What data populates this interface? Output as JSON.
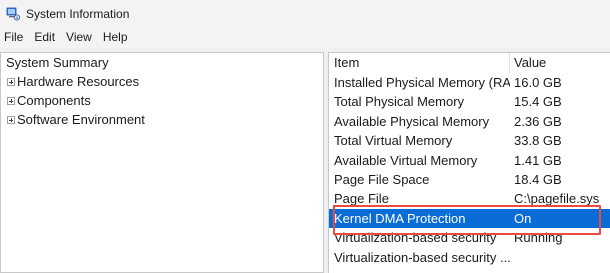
{
  "window": {
    "title": "System Information",
    "icon": "system-information-icon"
  },
  "menu": [
    {
      "label": "File"
    },
    {
      "label": "Edit"
    },
    {
      "label": "View"
    },
    {
      "label": "Help"
    }
  ],
  "tree": {
    "root": "System Summary",
    "children": [
      {
        "label": "Hardware Resources"
      },
      {
        "label": "Components"
      },
      {
        "label": "Software Environment"
      }
    ]
  },
  "list": {
    "headers": {
      "item": "Item",
      "value": "Value"
    },
    "rows": [
      {
        "item": "Installed Physical Memory (RA...",
        "value": "16.0 GB",
        "selected": false
      },
      {
        "item": "Total Physical Memory",
        "value": "15.4 GB",
        "selected": false
      },
      {
        "item": "Available Physical Memory",
        "value": "2.36 GB",
        "selected": false
      },
      {
        "item": "Total Virtual Memory",
        "value": "33.8 GB",
        "selected": false
      },
      {
        "item": "Available Virtual Memory",
        "value": "1.41 GB",
        "selected": false
      },
      {
        "item": "Page File Space",
        "value": "18.4 GB",
        "selected": false
      },
      {
        "item": "Page File",
        "value": "C:\\pagefile.sys",
        "selected": false
      },
      {
        "item": "Kernel DMA Protection",
        "value": "On",
        "selected": true
      },
      {
        "item": "Virtualization-based security",
        "value": "Running",
        "selected": false
      },
      {
        "item": "Virtualization-based security ...",
        "value": "",
        "selected": false
      }
    ]
  },
  "colors": {
    "selection": "#0a6cd6",
    "annotation_box": "#e84c3d"
  }
}
